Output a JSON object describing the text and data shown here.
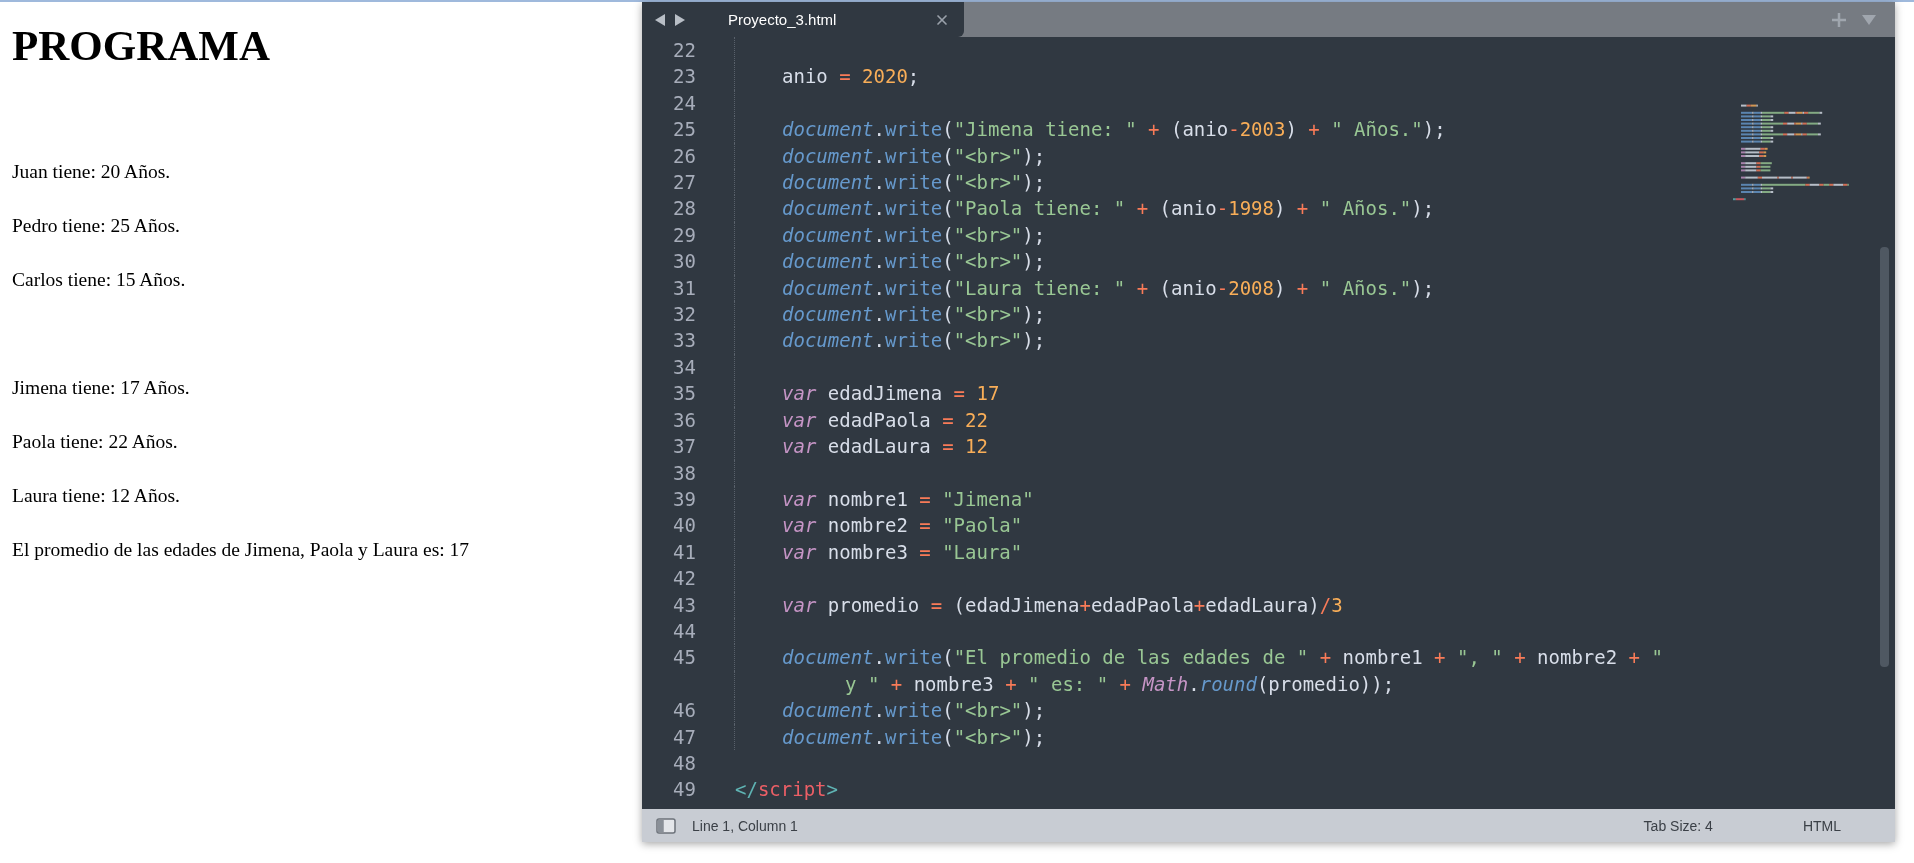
{
  "page": {
    "heading": "PROGRAMA",
    "output": [
      {
        "kind": "line",
        "text": "Juan tiene: 20 Años."
      },
      {
        "kind": "line",
        "text": "Pedro tiene: 25 Años."
      },
      {
        "kind": "line",
        "text": "Carlos tiene: 15 Años."
      },
      {
        "kind": "blank"
      },
      {
        "kind": "line",
        "text": "Jimena tiene: 17 Años."
      },
      {
        "kind": "line",
        "text": "Paola tiene: 22 Años."
      },
      {
        "kind": "line",
        "text": "Laura tiene: 12 Años."
      },
      {
        "kind": "line",
        "text": "El promedio de las edades de Jimena, Paola y Laura es: 17"
      }
    ]
  },
  "editor": {
    "tabs": [
      {
        "label": "Proyecto_3.html",
        "selected": true
      }
    ],
    "script_lines": [
      {
        "number": "22"
      },
      {
        "number": "23",
        "tokens": [
          {
            "kind": "plain",
            "text": "anio"
          },
          {
            "kind": "op",
            "text": " = "
          },
          {
            "kind": "num",
            "text": "2020"
          },
          {
            "kind": "plain",
            "text": ";"
          }
        ]
      },
      {
        "number": "24"
      },
      {
        "number": "25",
        "tokens": [
          {
            "kind": "obj",
            "text": "document"
          },
          {
            "kind": "plain",
            "text": "."
          },
          {
            "kind": "fn",
            "text": "write"
          },
          {
            "kind": "plain",
            "text": "("
          },
          {
            "kind": "str",
            "text": "\"Jimena tiene: \""
          },
          {
            "kind": "op",
            "text": " + "
          },
          {
            "kind": "plain",
            "text": "(anio"
          },
          {
            "kind": "op",
            "text": "-"
          },
          {
            "kind": "num",
            "text": "2003"
          },
          {
            "kind": "plain",
            "text": ")"
          },
          {
            "kind": "op",
            "text": " + "
          },
          {
            "kind": "str",
            "text": "\" Años.\""
          },
          {
            "kind": "plain",
            "text": ");"
          }
        ]
      },
      {
        "number": "26",
        "tokens": [
          {
            "kind": "obj",
            "text": "document"
          },
          {
            "kind": "plain",
            "text": "."
          },
          {
            "kind": "fn",
            "text": "write"
          },
          {
            "kind": "plain",
            "text": "("
          },
          {
            "kind": "str",
            "text": "\"<br>\""
          },
          {
            "kind": "plain",
            "text": ");"
          }
        ]
      },
      {
        "number": "27",
        "tokens": [
          {
            "kind": "obj",
            "text": "document"
          },
          {
            "kind": "plain",
            "text": "."
          },
          {
            "kind": "fn",
            "text": "write"
          },
          {
            "kind": "plain",
            "text": "("
          },
          {
            "kind": "str",
            "text": "\"<br>\""
          },
          {
            "kind": "plain",
            "text": ");"
          }
        ]
      },
      {
        "number": "28",
        "tokens": [
          {
            "kind": "obj",
            "text": "document"
          },
          {
            "kind": "plain",
            "text": "."
          },
          {
            "kind": "fn",
            "text": "write"
          },
          {
            "kind": "plain",
            "text": "("
          },
          {
            "kind": "str",
            "text": "\"Paola tiene: \""
          },
          {
            "kind": "op",
            "text": " + "
          },
          {
            "kind": "plain",
            "text": "(anio"
          },
          {
            "kind": "op",
            "text": "-"
          },
          {
            "kind": "num",
            "text": "1998"
          },
          {
            "kind": "plain",
            "text": ")"
          },
          {
            "kind": "op",
            "text": " + "
          },
          {
            "kind": "str",
            "text": "\" Años.\""
          },
          {
            "kind": "plain",
            "text": ");"
          }
        ]
      },
      {
        "number": "29",
        "tokens": [
          {
            "kind": "obj",
            "text": "document"
          },
          {
            "kind": "plain",
            "text": "."
          },
          {
            "kind": "fn",
            "text": "write"
          },
          {
            "kind": "plain",
            "text": "("
          },
          {
            "kind": "str",
            "text": "\"<br>\""
          },
          {
            "kind": "plain",
            "text": ");"
          }
        ]
      },
      {
        "number": "30",
        "tokens": [
          {
            "kind": "obj",
            "text": "document"
          },
          {
            "kind": "plain",
            "text": "."
          },
          {
            "kind": "fn",
            "text": "write"
          },
          {
            "kind": "plain",
            "text": "("
          },
          {
            "kind": "str",
            "text": "\"<br>\""
          },
          {
            "kind": "plain",
            "text": ");"
          }
        ]
      },
      {
        "number": "31",
        "tokens": [
          {
            "kind": "obj",
            "text": "document"
          },
          {
            "kind": "plain",
            "text": "."
          },
          {
            "kind": "fn",
            "text": "write"
          },
          {
            "kind": "plain",
            "text": "("
          },
          {
            "kind": "str",
            "text": "\"Laura tiene: \""
          },
          {
            "kind": "op",
            "text": " + "
          },
          {
            "kind": "plain",
            "text": "(anio"
          },
          {
            "kind": "op",
            "text": "-"
          },
          {
            "kind": "num",
            "text": "2008"
          },
          {
            "kind": "plain",
            "text": ")"
          },
          {
            "kind": "op",
            "text": " + "
          },
          {
            "kind": "str",
            "text": "\" Años.\""
          },
          {
            "kind": "plain",
            "text": ");"
          }
        ]
      },
      {
        "number": "32",
        "tokens": [
          {
            "kind": "obj",
            "text": "document"
          },
          {
            "kind": "plain",
            "text": "."
          },
          {
            "kind": "fn",
            "text": "write"
          },
          {
            "kind": "plain",
            "text": "("
          },
          {
            "kind": "str",
            "text": "\"<br>\""
          },
          {
            "kind": "plain",
            "text": ");"
          }
        ]
      },
      {
        "number": "33",
        "tokens": [
          {
            "kind": "obj",
            "text": "document"
          },
          {
            "kind": "plain",
            "text": "."
          },
          {
            "kind": "fn",
            "text": "write"
          },
          {
            "kind": "plain",
            "text": "("
          },
          {
            "kind": "str",
            "text": "\"<br>\""
          },
          {
            "kind": "plain",
            "text": ");"
          }
        ]
      },
      {
        "number": "34"
      },
      {
        "number": "35",
        "tokens": [
          {
            "kind": "kw",
            "text": "var"
          },
          {
            "kind": "plain",
            "text": " edadJimena"
          },
          {
            "kind": "op",
            "text": " = "
          },
          {
            "kind": "num",
            "text": "17"
          }
        ]
      },
      {
        "number": "36",
        "tokens": [
          {
            "kind": "kw",
            "text": "var"
          },
          {
            "kind": "plain",
            "text": " edadPaola"
          },
          {
            "kind": "op",
            "text": " = "
          },
          {
            "kind": "num",
            "text": "22"
          }
        ]
      },
      {
        "number": "37",
        "tokens": [
          {
            "kind": "kw",
            "text": "var"
          },
          {
            "kind": "plain",
            "text": " edadLaura"
          },
          {
            "kind": "op",
            "text": " = "
          },
          {
            "kind": "num",
            "text": "12"
          }
        ]
      },
      {
        "number": "38"
      },
      {
        "number": "39",
        "tokens": [
          {
            "kind": "kw",
            "text": "var"
          },
          {
            "kind": "plain",
            "text": " nombre1"
          },
          {
            "kind": "op",
            "text": " = "
          },
          {
            "kind": "str",
            "text": "\"Jimena\""
          }
        ]
      },
      {
        "number": "40",
        "tokens": [
          {
            "kind": "kw",
            "text": "var"
          },
          {
            "kind": "plain",
            "text": " nombre2"
          },
          {
            "kind": "op",
            "text": " = "
          },
          {
            "kind": "str",
            "text": "\"Paola\""
          }
        ]
      },
      {
        "number": "41",
        "tokens": [
          {
            "kind": "kw",
            "text": "var"
          },
          {
            "kind": "plain",
            "text": " nombre3"
          },
          {
            "kind": "op",
            "text": " = "
          },
          {
            "kind": "str",
            "text": "\"Laura\""
          }
        ]
      },
      {
        "number": "42"
      },
      {
        "number": "43",
        "tokens": [
          {
            "kind": "kw",
            "text": "var"
          },
          {
            "kind": "plain",
            "text": " promedio"
          },
          {
            "kind": "op",
            "text": " = "
          },
          {
            "kind": "plain",
            "text": "(edadJimena"
          },
          {
            "kind": "op",
            "text": "+"
          },
          {
            "kind": "plain",
            "text": "edadPaola"
          },
          {
            "kind": "op",
            "text": "+"
          },
          {
            "kind": "plain",
            "text": "edadLaura)"
          },
          {
            "kind": "op",
            "text": "/"
          },
          {
            "kind": "num",
            "text": "3"
          }
        ]
      },
      {
        "number": "44"
      },
      {
        "number": "45",
        "tokens": [
          {
            "kind": "obj",
            "text": "document"
          },
          {
            "kind": "plain",
            "text": "."
          },
          {
            "kind": "fn",
            "text": "write"
          },
          {
            "kind": "plain",
            "text": "("
          },
          {
            "kind": "str",
            "text": "\"El promedio de las edades de \""
          },
          {
            "kind": "op",
            "text": " + "
          },
          {
            "kind": "plain",
            "text": "nombre1"
          },
          {
            "kind": "op",
            "text": " + "
          },
          {
            "kind": "str",
            "text": "\", \""
          },
          {
            "kind": "op",
            "text": " + "
          },
          {
            "kind": "plain",
            "text": "nombre2"
          },
          {
            "kind": "op",
            "text": " + "
          },
          {
            "kind": "str",
            "text": "\""
          }
        ],
        "continuation": [
          {
            "kind": "str",
            "text": "y \""
          },
          {
            "kind": "op",
            "text": " + "
          },
          {
            "kind": "plain",
            "text": "nombre3"
          },
          {
            "kind": "op",
            "text": " + "
          },
          {
            "kind": "str",
            "text": "\" es: \""
          },
          {
            "kind": "op",
            "text": " + "
          },
          {
            "kind": "kw",
            "text": "Math"
          },
          {
            "kind": "plain",
            "text": "."
          },
          {
            "kind": "obj",
            "text": "round"
          },
          {
            "kind": "plain",
            "text": "(promedio));"
          }
        ]
      },
      {
        "number": "46",
        "tokens": [
          {
            "kind": "obj",
            "text": "document"
          },
          {
            "kind": "plain",
            "text": "."
          },
          {
            "kind": "fn",
            "text": "write"
          },
          {
            "kind": "plain",
            "text": "("
          },
          {
            "kind": "str",
            "text": "\"<br>\""
          },
          {
            "kind": "plain",
            "text": ");"
          }
        ]
      },
      {
        "number": "47",
        "tokens": [
          {
            "kind": "obj",
            "text": "document"
          },
          {
            "kind": "plain",
            "text": "."
          },
          {
            "kind": "fn",
            "text": "write"
          },
          {
            "kind": "plain",
            "text": "("
          },
          {
            "kind": "str",
            "text": "\"<br>\""
          },
          {
            "kind": "plain",
            "text": ");"
          }
        ]
      }
    ],
    "trailing_lines": [
      {
        "number": "48"
      },
      {
        "number": "49",
        "tokens": [
          {
            "kind": "punct",
            "text": "</"
          },
          {
            "kind": "tag",
            "text": "script"
          },
          {
            "kind": "punct",
            "text": ">"
          }
        ]
      }
    ],
    "status_bar": {
      "position": "Line 1, Column 1",
      "tab_size": "Tab Size: 4",
      "syntax": "HTML"
    }
  }
}
